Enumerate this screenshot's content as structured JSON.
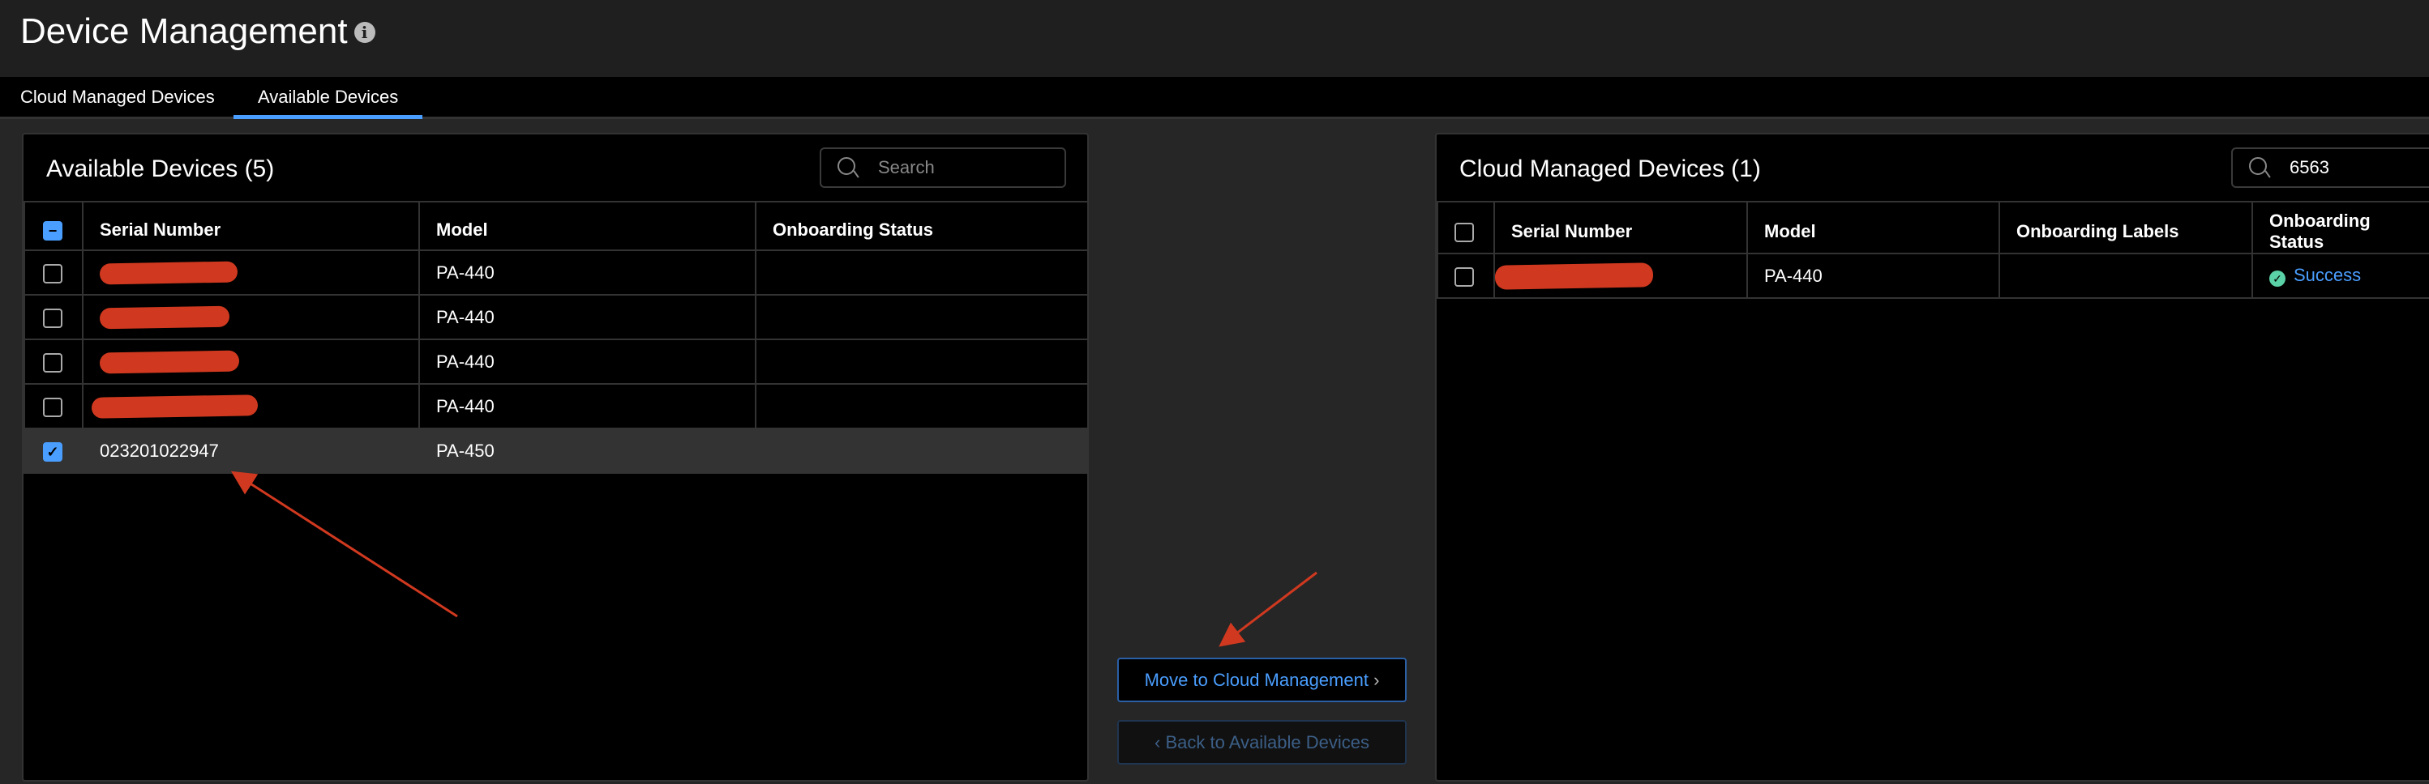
{
  "header": {
    "title": "Device Management",
    "info_icon": "info-icon"
  },
  "tabs": [
    {
      "label": "Cloud Managed Devices",
      "active": false
    },
    {
      "label": "Available Devices",
      "active": true
    }
  ],
  "available": {
    "title": "Available Devices (5)",
    "search_placeholder": "Search",
    "columns": [
      "Serial Number",
      "Model",
      "Onboarding Status"
    ],
    "rows": [
      {
        "serial": "",
        "model": "PA-440",
        "status": "",
        "redacted": true,
        "checked": false
      },
      {
        "serial": "",
        "model": "PA-440",
        "status": "",
        "redacted": true,
        "checked": false
      },
      {
        "serial": "",
        "model": "PA-440",
        "status": "",
        "redacted": true,
        "checked": false
      },
      {
        "serial": "",
        "model": "PA-440",
        "status": "",
        "redacted": true,
        "checked": false
      },
      {
        "serial": "023201022947",
        "model": "PA-450",
        "status": "",
        "redacted": false,
        "checked": true
      }
    ]
  },
  "actions": {
    "move": "Move to Cloud Management",
    "back": "Back to Available Devices"
  },
  "cloud": {
    "title": "Cloud Managed Devices (1)",
    "search_value": "6563",
    "columns": [
      "Serial Number",
      "Model",
      "Onboarding Labels",
      "Onboarding Status"
    ],
    "rows": [
      {
        "serial": "",
        "model": "PA-440",
        "labels": "",
        "status": "Success",
        "redacted": true
      }
    ]
  },
  "colors": {
    "accent": "#4a9eff",
    "success": "#5ad1a6",
    "annotation": "#d0391f"
  }
}
